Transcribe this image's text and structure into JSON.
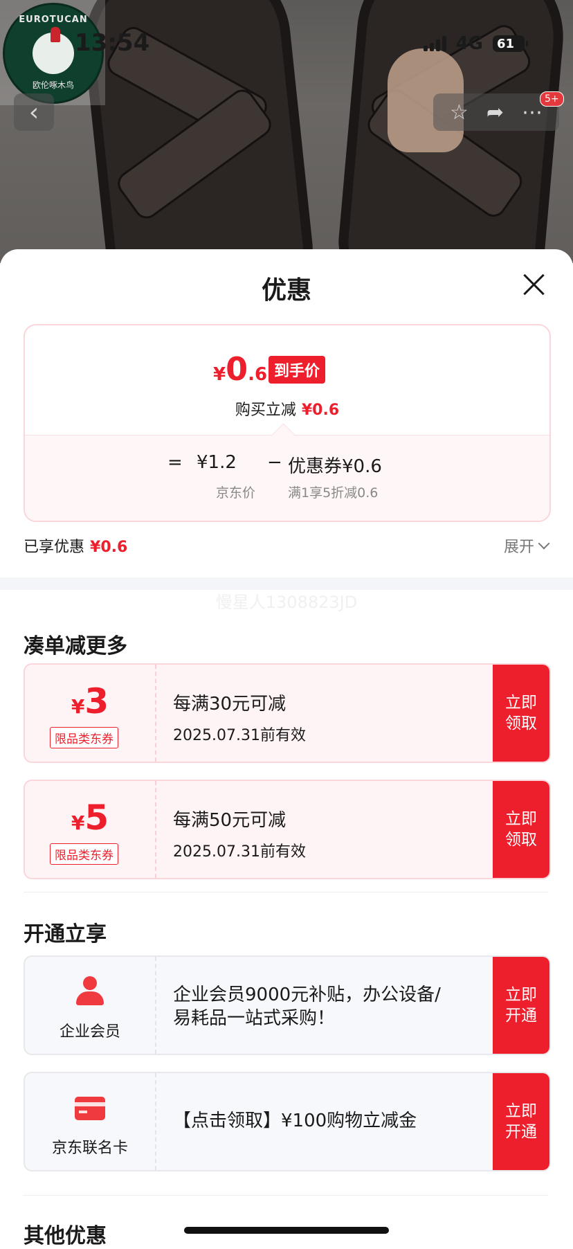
{
  "status_bar": {
    "time": "13:54",
    "network": "4G",
    "battery": "61"
  },
  "brand_logo": {
    "text_top": "EUROTUCAN",
    "text_bottom": "欧伦啄木鸟"
  },
  "top_nav": {
    "cart_badge": "5+"
  },
  "sheet": {
    "title": "优惠",
    "price_card": {
      "currency": "¥",
      "final_price_int": "0",
      "final_price_dec": ".6",
      "final_tag": "到手价",
      "instant_label": "购买立减",
      "instant_value": "¥0.6",
      "equals": "=",
      "jd_price": "¥1.2",
      "minus": "−",
      "coupon_label": "优惠券¥0.6",
      "jd_price_caption": "京东价",
      "coupon_caption": "满1享5折减0.6"
    },
    "enjoyed": {
      "label": "已享优惠",
      "value": "¥0.6"
    },
    "expand_label": "展开",
    "watermark": "慢星人1308823JD",
    "section_more": "凑单减更多",
    "coupons": [
      {
        "currency": "¥",
        "amount": "3",
        "tag": "限品类东券",
        "desc": "每满30元可减",
        "valid": "2025.07.31前有效",
        "button": "立即领取"
      },
      {
        "currency": "¥",
        "amount": "5",
        "tag": "限品类东券",
        "desc": "每满50元可减",
        "valid": "2025.07.31前有效",
        "button": "立即领取"
      }
    ],
    "section_open": "开通立享",
    "memberships": [
      {
        "icon": "person-icon",
        "label": "企业会员",
        "desc": "企业会员9000元补贴，办公设备/易耗品一站式采购！",
        "button": "立即开通"
      },
      {
        "icon": "credit-card-icon",
        "label": "京东联名卡",
        "desc": "【点击领取】¥100购物立减金",
        "button": "立即开通"
      }
    ],
    "section_other": "其他优惠"
  },
  "colors": {
    "accent_red": "#ee1f2c",
    "coupon_bg": "#fff4f5",
    "member_bg": "#f7f8fb"
  }
}
